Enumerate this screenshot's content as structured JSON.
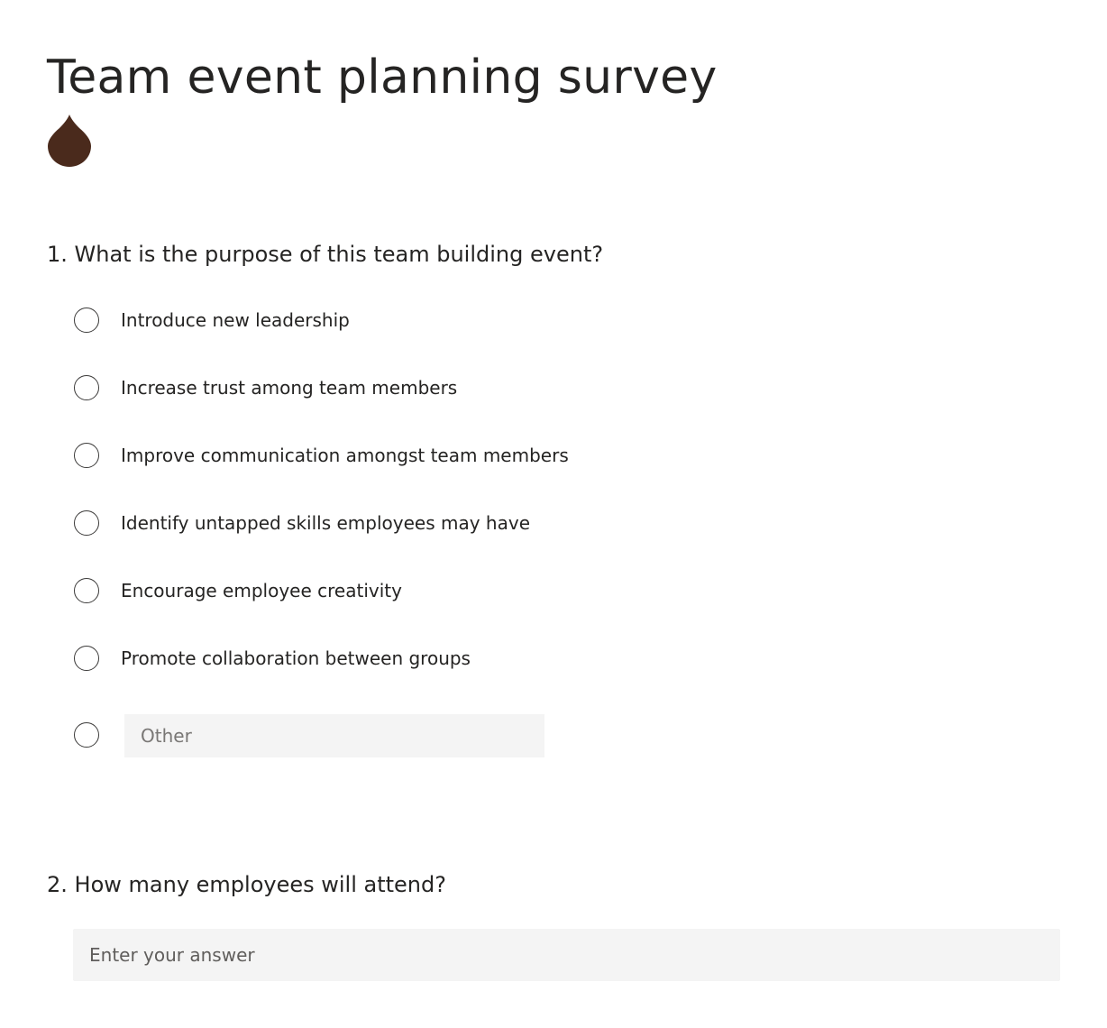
{
  "form": {
    "title": "Team event planning survey",
    "logo_icon": "droplet-icon",
    "logo_color": "#4a2a1c"
  },
  "questions": [
    {
      "title": "1. What is the purpose of this team building event?",
      "options": [
        {
          "label": "Introduce new leadership"
        },
        {
          "label": "Increase trust among team members"
        },
        {
          "label": "Improve communication amongst team members"
        },
        {
          "label": "Identify untapped skills employees may have"
        },
        {
          "label": "Encourage employee creativity"
        },
        {
          "label": "Promote collaboration between groups"
        }
      ],
      "other": {
        "value": "",
        "placeholder": "Other"
      }
    },
    {
      "title": "2. How many employees will attend?",
      "answer": {
        "value": "",
        "placeholder": "Enter your answer"
      }
    }
  ]
}
